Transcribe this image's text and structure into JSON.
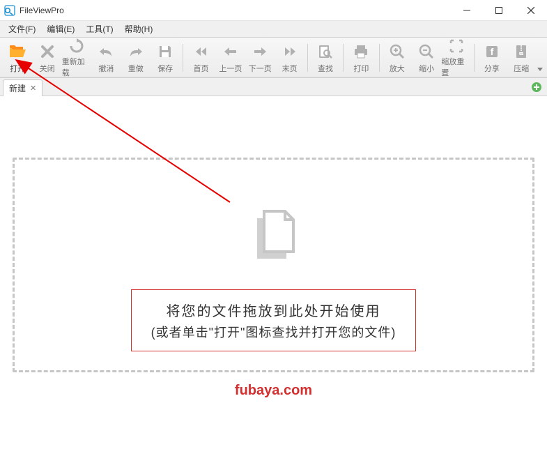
{
  "window": {
    "title": "FileViewPro"
  },
  "menu": {
    "file": "文件(F)",
    "edit": "编辑(E)",
    "tools": "工具(T)",
    "help": "帮助(H)"
  },
  "toolbar": {
    "open": {
      "label": "打开",
      "icon": "folder-open-icon",
      "enabled": true
    },
    "close": {
      "label": "关闭",
      "icon": "x-icon"
    },
    "reload": {
      "label": "重新加载",
      "icon": "refresh-icon"
    },
    "undo": {
      "label": "撤消",
      "icon": "undo-icon"
    },
    "redo": {
      "label": "重做",
      "icon": "redo-icon"
    },
    "save": {
      "label": "保存",
      "icon": "save-icon"
    },
    "first": {
      "label": "首页",
      "icon": "first-icon"
    },
    "prev": {
      "label": "上一页",
      "icon": "prev-icon"
    },
    "next": {
      "label": "下一页",
      "icon": "next-icon"
    },
    "last": {
      "label": "末页",
      "icon": "last-icon"
    },
    "find": {
      "label": "查找",
      "icon": "search-icon"
    },
    "print": {
      "label": "打印",
      "icon": "print-icon"
    },
    "zoomin": {
      "label": "放大",
      "icon": "zoom-in-icon"
    },
    "zoomout": {
      "label": "缩小",
      "icon": "zoom-out-icon"
    },
    "zoomreset": {
      "label": "缩放重置",
      "icon": "zoom-reset-icon"
    },
    "share": {
      "label": "分享",
      "icon": "share-icon"
    },
    "zip": {
      "label": "压缩",
      "icon": "zip-icon"
    }
  },
  "tabs": {
    "items": [
      {
        "label": "新建"
      }
    ]
  },
  "dropzone": {
    "line1": "将您的文件拖放到此处开始使用",
    "line2": "(或者单击\"打开\"图标查找并打开您的文件)"
  },
  "watermark": "fubaya.com"
}
